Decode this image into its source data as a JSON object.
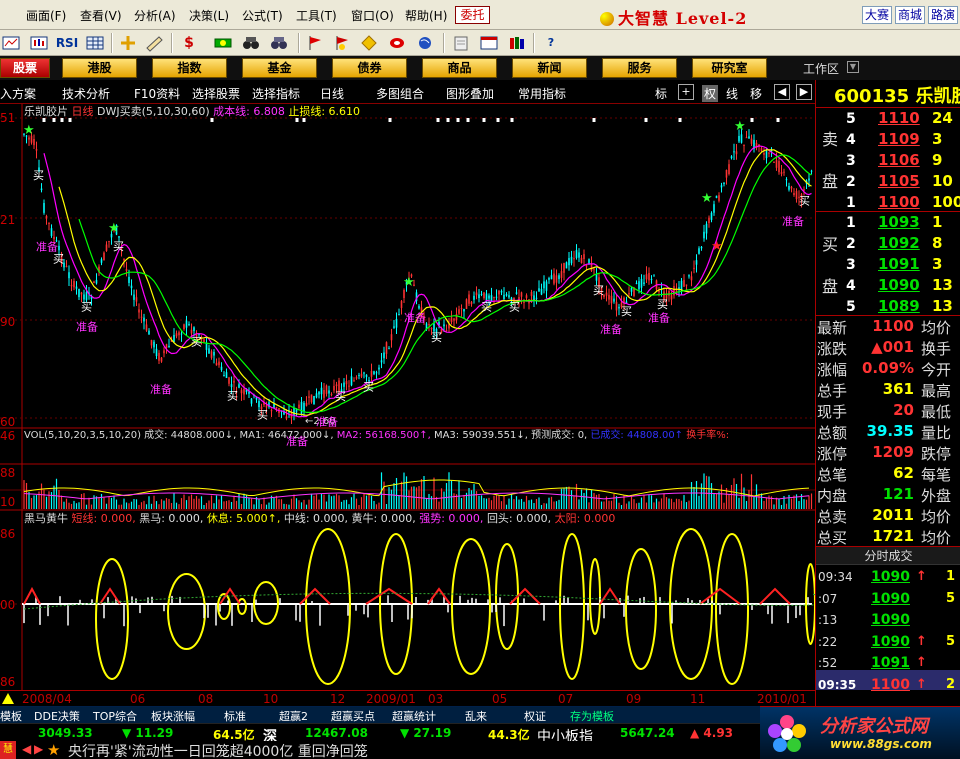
{
  "menu": {
    "items": [
      "画面(F)",
      "查看(V)",
      "分析(A)",
      "决策(L)",
      "公式(T)",
      "工具(T)",
      "窗口(O)",
      "帮助(H)"
    ],
    "weituo": "委托",
    "brand": "大智慧 Level-2",
    "right_buttons": [
      "大赛",
      "商城",
      "路演"
    ]
  },
  "toolbar": {
    "icons": [
      "screen-icon",
      "kline-icon",
      "rsi-icon",
      "grid-icon",
      "cross-icon",
      "ruler-icon",
      "dollar-icon",
      "capital-icon",
      "binoculars-icon",
      "flag-icon",
      "diamond-icon",
      "coin-icon",
      "globe-icon",
      "note-icon",
      "window-icon",
      "books-icon",
      "help-icon"
    ],
    "rsi_label": "RSI",
    "dollar_label": "$"
  },
  "nav": {
    "items": [
      "股票",
      "港股",
      "指数",
      "基金",
      "债券",
      "商品",
      "新闻",
      "服务",
      "研究室"
    ],
    "workspace": "工作区"
  },
  "tabs": {
    "items": [
      "入方案",
      "技术分析",
      "F10资料",
      "选择股票",
      "选择指标",
      "日线",
      "多图组合",
      "图形叠加",
      "常用指标"
    ],
    "right": [
      "标",
      "权",
      "线",
      "移"
    ]
  },
  "chart": {
    "stock_label": "乐凯胶片",
    "period": "日线",
    "formula": "DWJ买卖(5,10,30,60)",
    "cost_line": "成本线: 6.808",
    "stop_line": "止损线: 6.610",
    "low_mark": "←2.60",
    "y_ticks": [
      "51",
      "21",
      "90",
      "60"
    ],
    "vol_line": [
      "VOL(5,10,20,3,5,10,20)",
      "成交: 44808.000↓,",
      "MA1: 46472.000↓,",
      "MA2: 56168.500↑,",
      "MA3: 59039.551↓,",
      "预测成交: 0,",
      "已成交: 44808.00↑",
      "换手率%:"
    ],
    "vol_ticks": [
      "46",
      "88",
      "10"
    ],
    "ind_line": [
      "黑马黄牛",
      "短线: 0.000,",
      "黑马: 0.000,",
      "休息: 5.000↑,",
      "中线: 0.000,",
      "黄牛: 0.000,",
      "强势: 0.000,",
      "回头: 0.000,",
      "太阳: 0.000"
    ],
    "ind_ticks": [
      "86",
      "00",
      "86"
    ],
    "labels": {
      "buy": "买",
      "ready": "准备"
    }
  },
  "datebar": {
    "dates": [
      "2008/04",
      "06",
      "08",
      "10",
      "12",
      "2009/01",
      "03",
      "05",
      "07",
      "09",
      "11",
      "2010/01"
    ]
  },
  "bottom_tabs": [
    "模板",
    "DDE决策",
    "TOP综合",
    "板块涨幅",
    "标准",
    "超赢2",
    "超赢买点",
    "超赢统计",
    "乱来",
    "权证",
    "存为模板"
  ],
  "ticker": {
    "items": [
      "3049.33",
      "▼ 11.29",
      "64.5亿",
      "深",
      "12467.08",
      "▼ 27.19",
      "44.3亿",
      "中小板指",
      "5647.24",
      "▲ 4.93"
    ]
  },
  "news": "央行再'紧'流动性一日回笼超4000亿 重回净回笼",
  "quote": {
    "code": "600135",
    "name": "乐凯胶片",
    "sell_label": [
      "卖",
      "盘"
    ],
    "buy_label": [
      "买",
      "盘"
    ],
    "asks": [
      {
        "lv": "5",
        "price": "1110",
        "vol": "24"
      },
      {
        "lv": "4",
        "price": "1109",
        "vol": "3"
      },
      {
        "lv": "3",
        "price": "1106",
        "vol": "9"
      },
      {
        "lv": "2",
        "price": "1105",
        "vol": "10"
      },
      {
        "lv": "1",
        "price": "1100",
        "vol": "100"
      }
    ],
    "bids": [
      {
        "lv": "1",
        "price": "1093",
        "vol": "1"
      },
      {
        "lv": "2",
        "price": "1092",
        "vol": "8"
      },
      {
        "lv": "3",
        "price": "1091",
        "vol": "3"
      },
      {
        "lv": "4",
        "price": "1090",
        "vol": "13"
      },
      {
        "lv": "5",
        "price": "1089",
        "vol": "13"
      }
    ],
    "stats": [
      {
        "l": "最新",
        "v": "1100",
        "l2": "均价",
        "c": "#ff3333"
      },
      {
        "l": "涨跌",
        "v": "▲001",
        "l2": "换手",
        "c": "#ff3333"
      },
      {
        "l": "涨幅",
        "v": "0.09%",
        "l2": "今开",
        "c": "#ff3333"
      },
      {
        "l": "总手",
        "v": "361",
        "l2": "最高",
        "c": "#ffff00"
      },
      {
        "l": "现手",
        "v": "20",
        "l2": "最低",
        "c": "#ff3333"
      },
      {
        "l": "总额",
        "v": "39.35",
        "l2": "量比",
        "c": "#00ffff"
      },
      {
        "l": "涨停",
        "v": "1209",
        "l2": "跌停",
        "c": "#ff3333"
      },
      {
        "l": "总笔",
        "v": "62",
        "l2": "每笔",
        "c": "#ffff00"
      },
      {
        "l": "内盘",
        "v": "121",
        "l2": "外盘",
        "c": "#00e000"
      },
      {
        "l": "总卖",
        "v": "2011",
        "l2": "均价",
        "c": "#ffff00"
      },
      {
        "l": "总买",
        "v": "1721",
        "l2": "均价",
        "c": "#ffff00"
      }
    ],
    "ticks_title": "分时成交",
    "ticks": [
      {
        "t": "09:34",
        "p": "1090",
        "a": "↑",
        "v": "1"
      },
      {
        "t": ":07",
        "p": "1090",
        "a": "",
        "v": "5"
      },
      {
        "t": ":13",
        "p": "1090",
        "a": "",
        "v": ""
      },
      {
        "t": ":22",
        "p": "1090",
        "a": "↑",
        "v": "5"
      },
      {
        "t": ":52",
        "p": "1091",
        "a": "↑",
        "v": ""
      },
      {
        "t": "09:35",
        "p": "1100",
        "a": "↑",
        "v": "2"
      }
    ]
  },
  "logo": {
    "title": "分析家公式网",
    "url": "www.88gs.com"
  },
  "colors": {
    "up": "#ff3333",
    "down": "#00ffff",
    "ma1": "#ff00ff",
    "ma2": "#ffff00",
    "ma3": "#00ff00",
    "border": "#aa0000",
    "indicator": "#ffff00"
  }
}
